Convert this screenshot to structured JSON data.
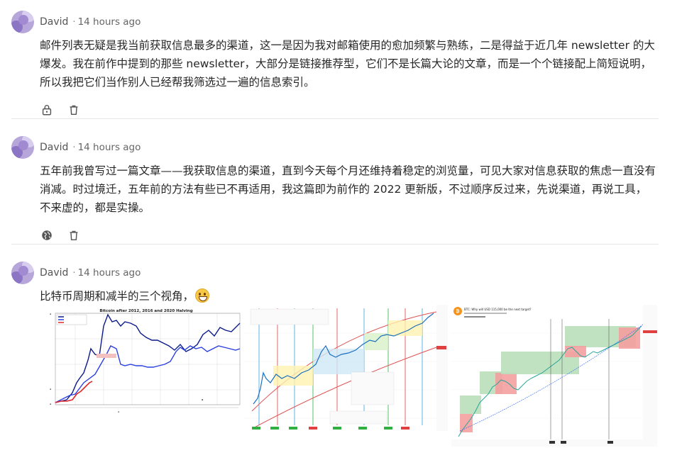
{
  "posts": [
    {
      "author": "David",
      "separator": "·",
      "time": "14 hours ago",
      "text": "邮件列表无疑是我当前获取信息最多的渠道，这一是因为我对邮箱使用的愈加频繁与熟练，二是得益于近几年 newsletter 的大爆发。我在前作中提到的那些 newsletter，大部分是链接推荐型，它们不是长篇大论的文章，而是一个个链接配上简短说明，所以我把它们当作别人已经帮我筛选过一遍的信息索引。",
      "visibility_icon": "lock-icon",
      "delete_icon": "trash-icon"
    },
    {
      "author": "David",
      "separator": "·",
      "time": "14 hours ago",
      "text": "五年前我曾写过一篇文章——我获取信息的渠道，直到今天每个月还维持着稳定的浏览量，可见大家对信息获取的焦虑一直没有消减。时过境迁，五年前的方法有些已不再适用，我这篇即为前作的 2022 更新版，不过顺序反过来，先说渠道，再说工具，不来虚的，都是实操。",
      "visibility_icon": "globe-icon",
      "delete_icon": "trash-icon"
    },
    {
      "author": "David",
      "separator": "·",
      "time": "14 hours ago",
      "text": "比特币周期和减半的三个视角，",
      "emoji": "grinning-face-emoji"
    }
  ],
  "images": [
    {
      "name": "bitcoin-halving-comparison-chart",
      "title": "Bitcoin after 2012, 2016 and 2020 Halving"
    },
    {
      "name": "bitcoin-log-regression-cycle-chart"
    },
    {
      "name": "btc-tradingview-cycle-chart",
      "title": "BTC: Why will USD 115,000 be the next target?"
    }
  ],
  "colors": {
    "text": "#262626",
    "meta": "#666666",
    "divider": "#e6e6e6",
    "avatar": "#b7a6d9"
  }
}
